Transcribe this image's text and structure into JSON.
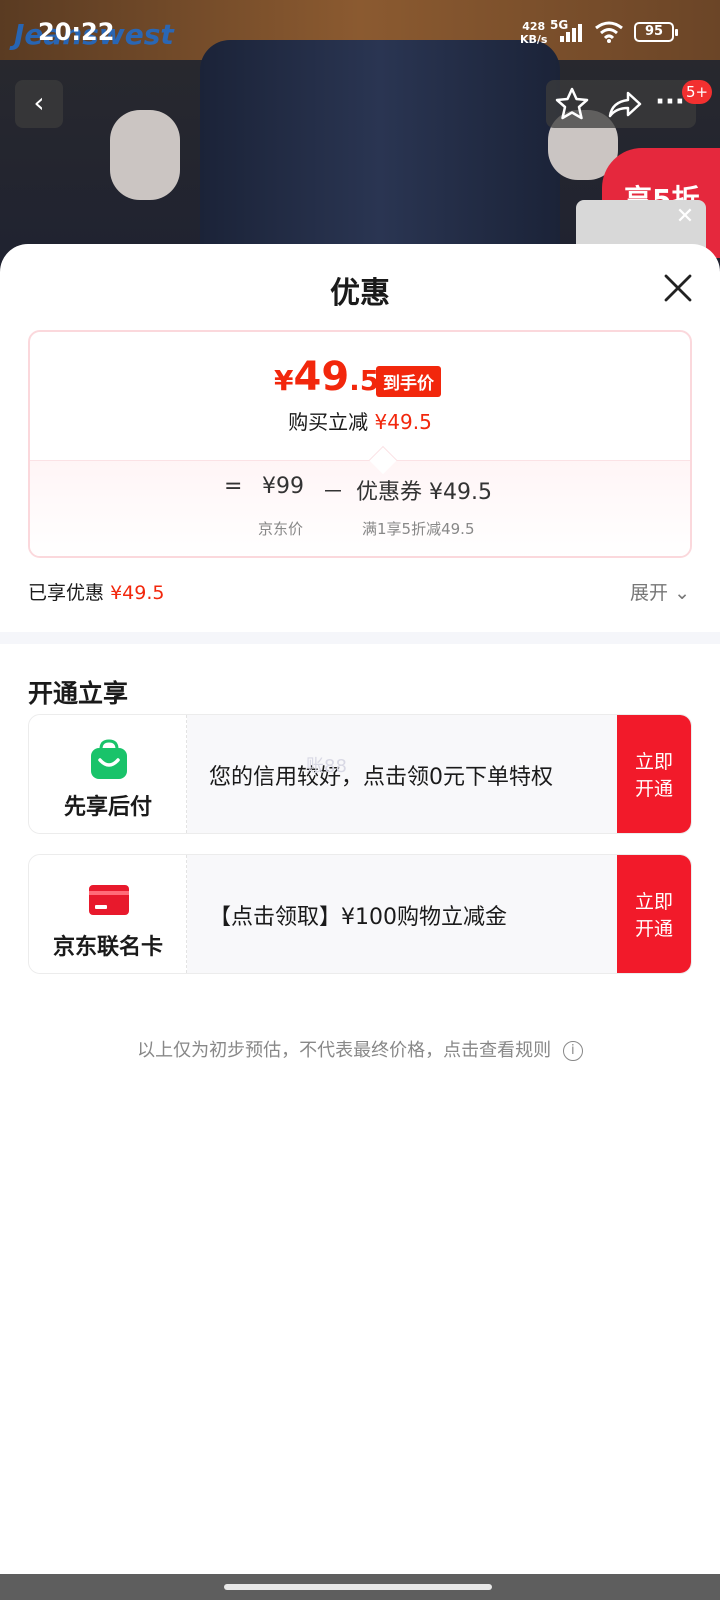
{
  "status_bar": {
    "time": "20:22",
    "net_speed_value": "428",
    "net_speed_unit": "KB/s",
    "network": "5G",
    "battery": "95"
  },
  "background": {
    "brand_text": "Jeanswest",
    "promo_text": "享5折"
  },
  "nav": {
    "back_icon": "chevron-left-icon",
    "badge": "5+"
  },
  "sheet": {
    "title": "优惠",
    "price": {
      "yen": "¥",
      "int": "49",
      "dec": ".5",
      "tag": "到手价",
      "instant_cut_label": "购买立减",
      "instant_cut_value": "¥49.5"
    },
    "calc": {
      "equals": "=",
      "base_price": "¥99",
      "minus": "－",
      "coupon_label": "优惠券",
      "coupon_value": "¥49.5",
      "base_caption": "京东价",
      "coupon_caption": "满1享5折减49.5"
    },
    "enjoyed_label": "已享优惠",
    "enjoyed_value": "¥49.5",
    "expand_label": "展开"
  },
  "open_section": {
    "title": "开通立享",
    "cards": [
      {
        "left_label": "先享后付",
        "text": "您的信用较好，点击领0元下单特权",
        "button": [
          "立即",
          "开通"
        ],
        "icon": "shopping-bag-icon"
      },
      {
        "left_label": "京东联名卡",
        "text": "【点击领取】¥100购物立减金",
        "button": [
          "立即",
          "开通"
        ],
        "icon": "credit-card-icon"
      }
    ],
    "watermark": "账88"
  },
  "footnote": "以上仅为初步预估，不代表最终价格，点击查看规则",
  "colors": {
    "accent": "#f2270c",
    "button": "#f21a2a",
    "green": "#19c36a"
  }
}
